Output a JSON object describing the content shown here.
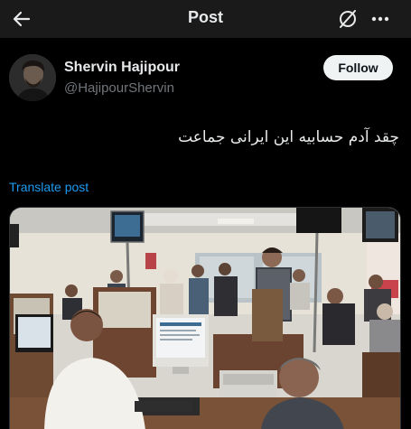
{
  "header": {
    "title": "Post",
    "back_icon": "arrow-left-icon",
    "mute_icon": "mute-conversation-icon",
    "more_icon": "more-horizontal-icon"
  },
  "author": {
    "name": "Shervin Hajipour",
    "handle": "@HajipourShervin",
    "avatar_icon": "avatar-photo"
  },
  "follow_button": {
    "label": "Follow"
  },
  "post": {
    "text": "چقد آدم حسابیه این ایرانی جماعت",
    "translate_label": "Translate post"
  },
  "media": {
    "description_icon": "photo-office-service-counter"
  },
  "colors": {
    "background": "#000000",
    "topbar": "#1a1a1a",
    "text_primary": "#e7e9ea",
    "text_secondary": "#71767b",
    "link": "#1d9bf0",
    "follow_bg": "#eff3f4",
    "follow_text": "#0f1419"
  }
}
